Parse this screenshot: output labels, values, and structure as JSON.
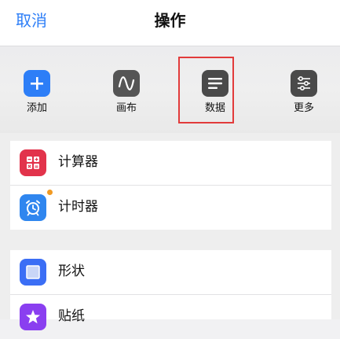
{
  "header": {
    "cancel_label": "取消",
    "title": "操作"
  },
  "toolbar": {
    "items": [
      {
        "label": "添加",
        "icon": "plus-icon",
        "color": "#2d7ef7"
      },
      {
        "label": "画布",
        "icon": "wave-icon",
        "color": "#555555"
      },
      {
        "label": "数据",
        "icon": "lines-icon",
        "color": "#4a4a4a",
        "highlighted": true
      },
      {
        "label": "更多",
        "icon": "sliders-icon",
        "color": "#4a4a4a"
      }
    ],
    "highlight_color": "#e23b3b"
  },
  "list": {
    "group1": [
      {
        "label": "计算器",
        "icon": "calculator-icon",
        "color": "#e2334b"
      },
      {
        "label": "计时器",
        "icon": "alarm-clock-icon",
        "color": "#2f86ef",
        "badge_dot_color": "#f19a23"
      }
    ],
    "group2": [
      {
        "label": "形状",
        "icon": "square-icon",
        "color": "#3b6ef5"
      },
      {
        "label": "贴纸",
        "icon": "star-icon",
        "color": "#8a3ff0"
      }
    ]
  }
}
